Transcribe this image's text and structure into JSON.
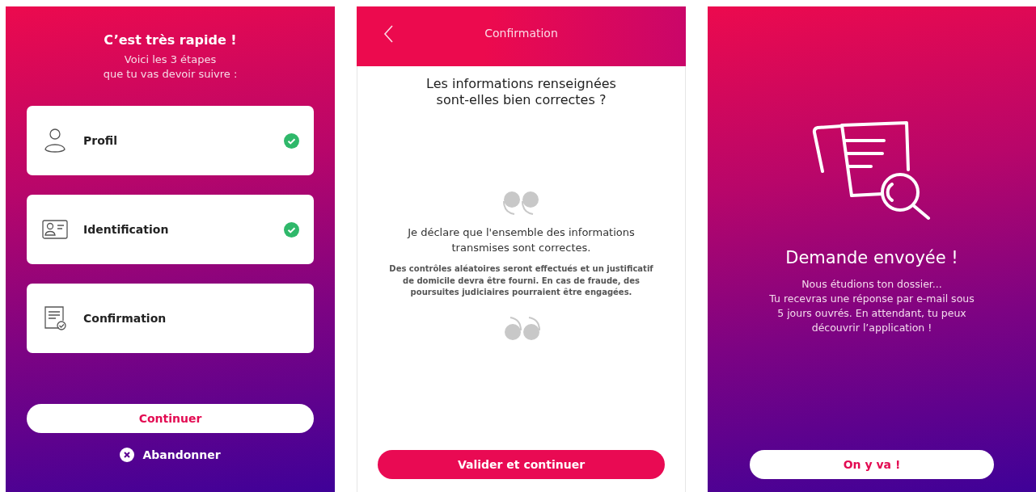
{
  "steps_screen": {
    "title": "C’est très rapide !",
    "subtitle": "Voici les 3 étapes\nque tu vas devoir suivre :",
    "steps": [
      {
        "label": "Profil",
        "kind": "person",
        "done": true
      },
      {
        "label": "Identification",
        "kind": "card",
        "done": true
      },
      {
        "label": "Confirmation",
        "kind": "document",
        "done": false
      }
    ],
    "continue_button": "Continuer",
    "cancel_link": "Abandonner"
  },
  "confirmation_screen": {
    "header_title": "Confirmation",
    "question": "Les informations renseignées\nsont-elles bien correctes ?",
    "declaration": "Je déclare que l'ensemble des informations\ntransmises sont correctes.",
    "notice": "Des contrôles aléatoires seront effectués et un justificatif de domicile devra être fourni. En cas de fraude, des poursuites judiciaires pourraient être engagées.",
    "validate_button": "Valider et continuer"
  },
  "sent_screen": {
    "title": "Demande envoyée !",
    "message": "Nous étudions ton dossier...\nTu recevras une réponse par e-mail sous\n5 jours ouvrés. En attendant, tu peux\ndécouvrir l’application !",
    "go_button": "On y va !"
  }
}
